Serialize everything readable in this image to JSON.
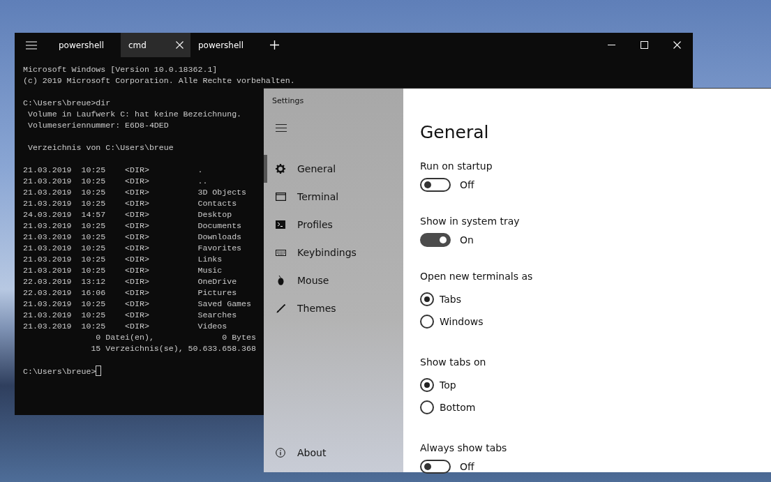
{
  "terminal": {
    "tabs": [
      {
        "label": "powershell",
        "selected": false
      },
      {
        "label": "cmd",
        "selected": true
      },
      {
        "label": "powershell",
        "selected": false
      }
    ],
    "blocks": [
      [
        "Microsoft Windows [Version 10.0.18362.1]",
        "(c) 2019 Microsoft Corporation. Alle Rechte vorbehalten."
      ],
      [
        "C:\\Users\\breue>dir",
        " Volume in Laufwerk C: hat keine Bezeichnung.",
        " Volumeseriennummer: E6D8-4DED"
      ],
      [
        " Verzeichnis von C:\\Users\\breue"
      ],
      [
        "21.03.2019  10:25    <DIR>          .",
        "21.03.2019  10:25    <DIR>          ..",
        "21.03.2019  10:25    <DIR>          3D Objects",
        "21.03.2019  10:25    <DIR>          Contacts",
        "24.03.2019  14:57    <DIR>          Desktop",
        "21.03.2019  10:25    <DIR>          Documents",
        "21.03.2019  10:25    <DIR>          Downloads",
        "21.03.2019  10:25    <DIR>          Favorites",
        "21.03.2019  10:25    <DIR>          Links",
        "21.03.2019  10:25    <DIR>          Music",
        "22.03.2019  13:12    <DIR>          OneDrive",
        "22.03.2019  16:06    <DIR>          Pictures",
        "21.03.2019  10:25    <DIR>          Saved Games",
        "21.03.2019  10:25    <DIR>          Searches",
        "21.03.2019  10:25    <DIR>          Videos",
        "               0 Datei(en),              0 Bytes",
        "              15 Verzeichnis(se), 50.633.658.368"
      ]
    ],
    "prompt": "C:\\Users\\breue>"
  },
  "settings": {
    "title": "Settings",
    "nav": [
      {
        "label": "General",
        "kind": "gear",
        "selected": true
      },
      {
        "label": "Terminal",
        "kind": "window",
        "selected": false
      },
      {
        "label": "Profiles",
        "kind": "console",
        "selected": false
      },
      {
        "label": "Keybindings",
        "kind": "keyboard",
        "selected": false
      },
      {
        "label": "Mouse",
        "kind": "mouse",
        "selected": false
      },
      {
        "label": "Themes",
        "kind": "brush",
        "selected": false
      }
    ],
    "about": "About",
    "heading": "General",
    "sections": [
      {
        "kind": "toggle",
        "label": "Run on startup",
        "on": false,
        "state_text": "Off"
      },
      {
        "kind": "toggle",
        "label": "Show in system tray",
        "on": true,
        "state_text": "On"
      },
      {
        "kind": "radio",
        "label": "Open new terminals as",
        "options": [
          {
            "label": "Tabs",
            "selected": true
          },
          {
            "label": "Windows",
            "selected": false
          }
        ]
      },
      {
        "kind": "radio",
        "label": "Show tabs on",
        "options": [
          {
            "label": "Top",
            "selected": true
          },
          {
            "label": "Bottom",
            "selected": false
          }
        ]
      },
      {
        "kind": "toggle",
        "label": "Always show tabs",
        "on": false,
        "state_text": "Off"
      }
    ]
  }
}
